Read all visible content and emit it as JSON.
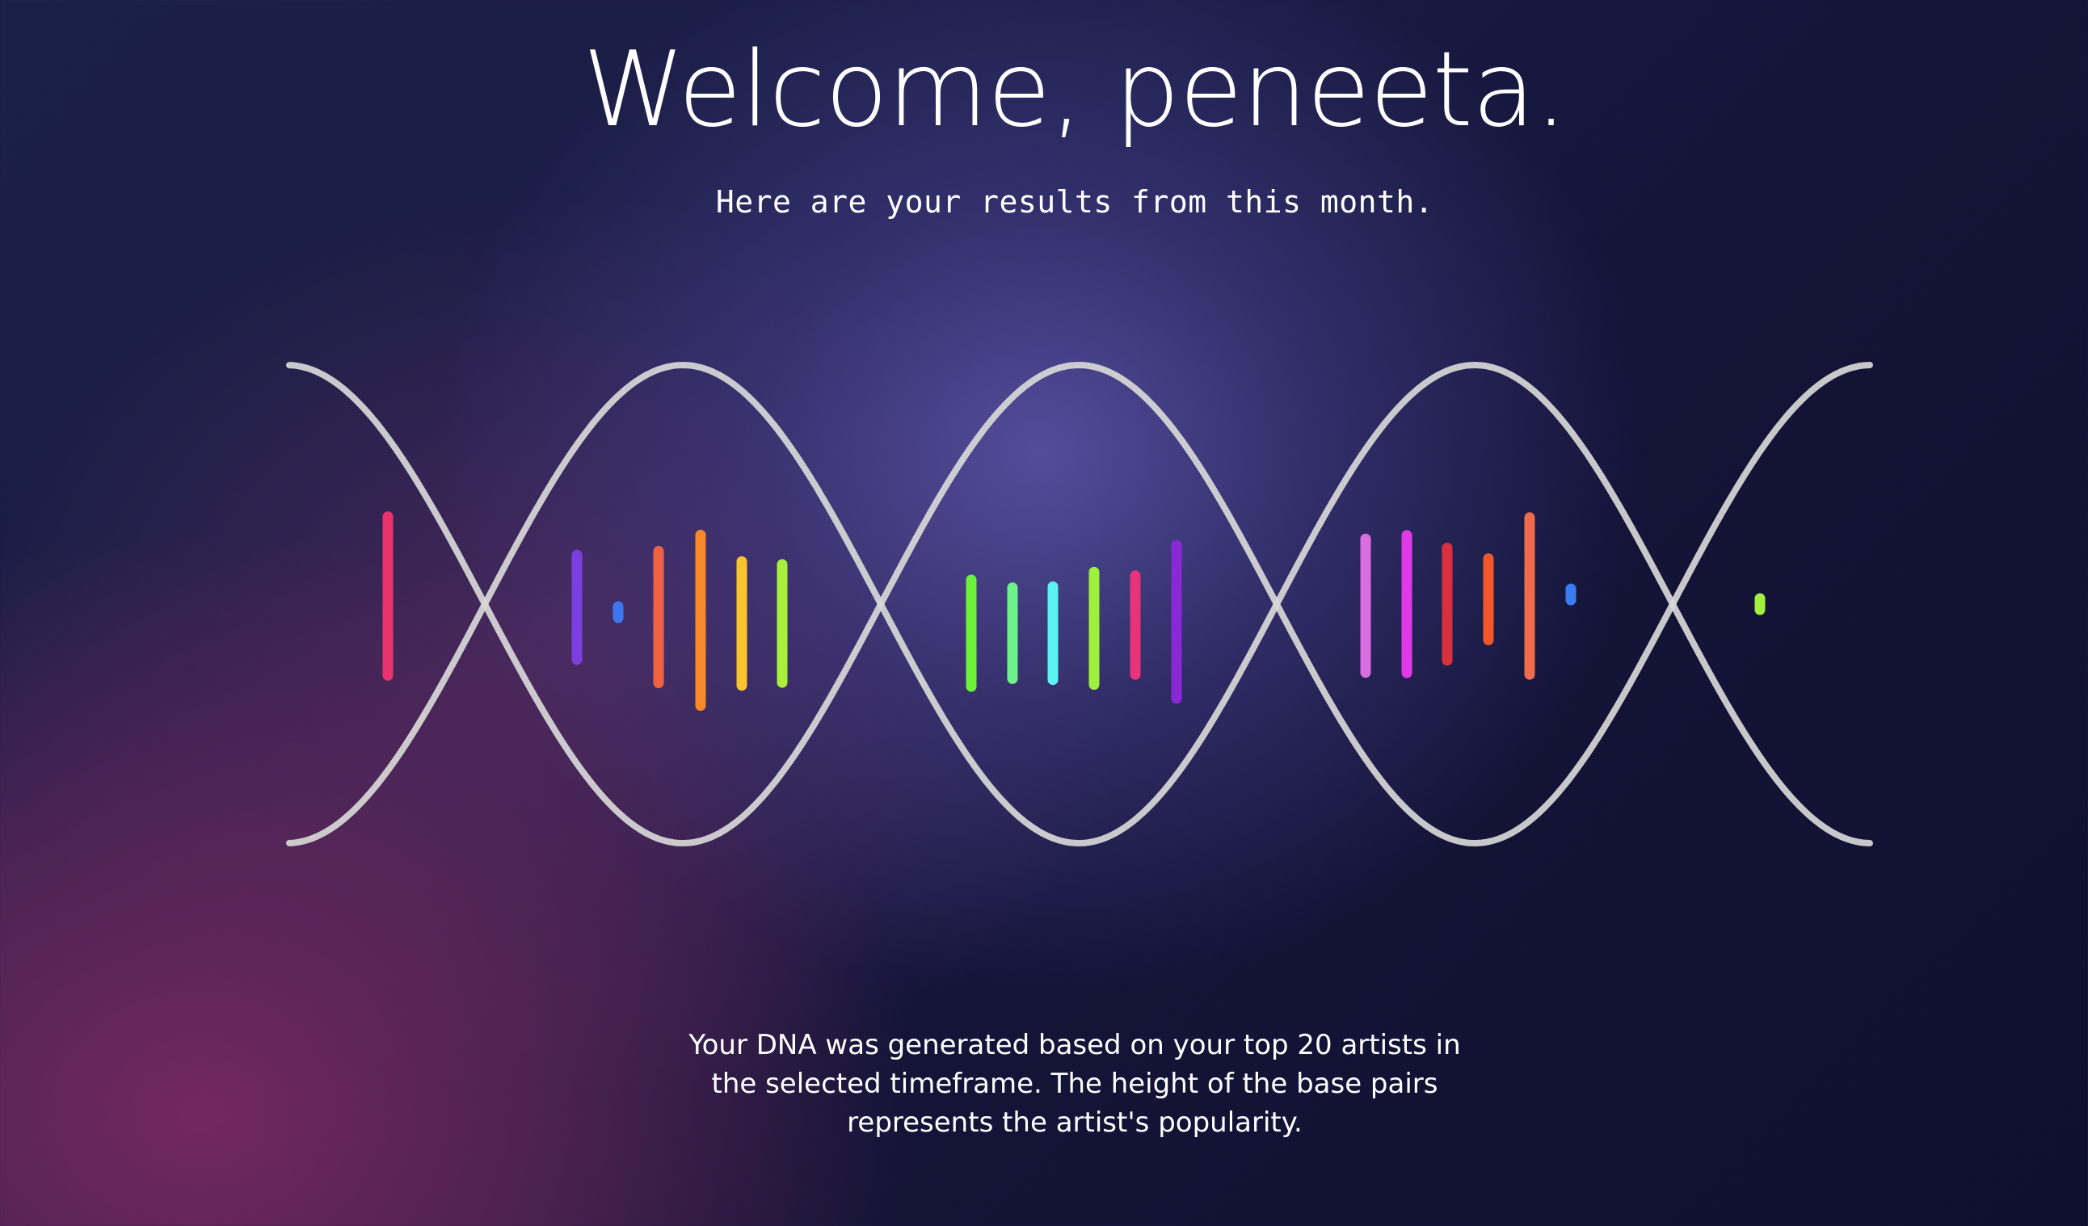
{
  "header": {
    "title": "Welcome, peneeta.",
    "subtitle": "Here are your results from this month."
  },
  "caption": {
    "text": "Your DNA was generated based on your top 20 artists in the selected timeframe. The height of the base pairs represents the artist's popularity."
  },
  "colors": {
    "strand": "#d8d8d8",
    "background_dark": "#12133a",
    "background_purple": "#5a54a8",
    "background_magenta": "#7a2a62"
  },
  "base_pairs": [
    {
      "color": "#e8336d",
      "popularity": 0.82
    },
    {
      "color": "#7b3fe0",
      "popularity": 0.54
    },
    {
      "color": "#3b78f0",
      "popularity": 0.05
    },
    {
      "color": "#f0623f",
      "popularity": 0.68
    },
    {
      "color": "#f7892b",
      "popularity": 0.88
    },
    {
      "color": "#f8c52c",
      "popularity": 0.64
    },
    {
      "color": "#a8f03a",
      "popularity": 0.61
    },
    {
      "color": "#6df23a",
      "popularity": 0.55
    },
    {
      "color": "#6ef08a",
      "popularity": 0.47
    },
    {
      "color": "#5cf2f2",
      "popularity": 0.48
    },
    {
      "color": "#9ef03c",
      "popularity": 0.58
    },
    {
      "color": "#e8337a",
      "popularity": 0.51
    },
    {
      "color": "#8a28d8",
      "popularity": 0.79
    },
    {
      "color": "#d86ee0",
      "popularity": 0.69
    },
    {
      "color": "#e03ae8",
      "popularity": 0.71
    },
    {
      "color": "#d8303c",
      "popularity": 0.58
    },
    {
      "color": "#f0582c",
      "popularity": 0.42
    },
    {
      "color": "#f06a4c",
      "popularity": 0.81
    },
    {
      "color": "#3b7cf0",
      "popularity": 0.03
    },
    {
      "color": "#9ef03c",
      "popularity": 0.03
    }
  ]
}
